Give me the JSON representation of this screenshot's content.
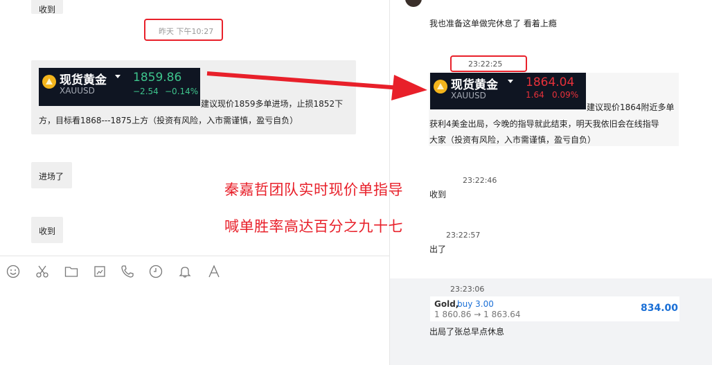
{
  "left": {
    "top_msg": "收到",
    "timestamp": "昨天  下午10:27",
    "quote": {
      "name": "现货黄金",
      "symbol": "XAUUSD",
      "price": "1859.86",
      "change": "−2.54",
      "change_pct": "−0.14%",
      "color": "#3ec48c"
    },
    "advice_line1": "建议现价1859多单进场，止损1852下",
    "advice_line2": "方，目标看1868---1875上方（投资有风险，入市需谨慎，盈亏自负）",
    "msg_entered": "进场了",
    "msg_received": "收到",
    "toolbar": [
      "smile-icon",
      "scissors-icon",
      "folder-icon",
      "screenshot-icon",
      "phone-icon",
      "clock-icon",
      "bell-icon",
      "font-icon"
    ]
  },
  "overlay": {
    "caption1": "秦嘉哲团队实时现价单指导",
    "caption2": "喊单胜率高达百分之九十七",
    "color": "#e8202a"
  },
  "right": {
    "top_msg": "我也准备这单做完休息了   看着上瘾",
    "timestamp1": "23:22:25",
    "quote": {
      "name": "现货黄金",
      "symbol": "XAUUSD",
      "price": "1864.04",
      "change": "1.64",
      "change_pct": "0.09%",
      "color": "#e8313a"
    },
    "advice_line1": "建议现价1864附近多单",
    "advice_line2": "获利4美金出局，今晚的指导就此结束，明天我依旧会在线指导",
    "advice_line3": "大家（投资有风险，入市需谨慎，盈亏自负）",
    "timestamp2": "23:22:46",
    "msg_received": "收到",
    "timestamp3": "23:22:57",
    "msg_out": "出了",
    "timestamp4": "23:23:06",
    "trade": {
      "asset": "Gold,",
      "action": "buy 3.00",
      "route": "1 860.86 → 1 863.64",
      "profit": "834.00",
      "accent": "#1a6fd6"
    },
    "final_msg": "出局了张总早点休息"
  }
}
